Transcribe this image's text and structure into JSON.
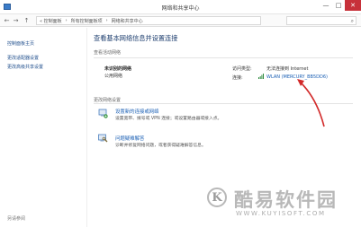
{
  "window": {
    "title": "网络和共享中心",
    "buttons": {
      "minimize": "—",
      "maximize": "□",
      "close": "✕"
    }
  },
  "address_bar": {
    "back": "←",
    "forward": "→",
    "up": "↑",
    "segments": [
      "« 控制面板",
      "›",
      "所有控制面板项",
      "›",
      "网络和共享中心"
    ],
    "search_icon": "search-icon"
  },
  "sidebar": {
    "items": [
      {
        "label": "控制面板主页"
      },
      {
        "label": "更改适配器设置"
      },
      {
        "label": "更改高级共享设置"
      }
    ],
    "footer": "另请参阅"
  },
  "main": {
    "heading": "查看基本网络信息并设置连接",
    "active_section": "查看活动网络",
    "network": {
      "name": "未识别的网络",
      "type": "公用网络",
      "access_label": "访问类型:",
      "access_value": "无法连接到 Internet",
      "conn_label": "连接:",
      "conn_value": "WLAN (MERCURY_BB5DD6)"
    },
    "change_section": "更改网络设置",
    "tasks": [
      {
        "link": "设置新的连接或网络",
        "desc": "设置宽带、拨号或 VPN 连接；或设置路由器或接入点。"
      },
      {
        "link": "问题疑难解答",
        "desc": "诊断并修复网络问题，或者获得疑难解答信息。"
      }
    ]
  },
  "watermark": {
    "logo_letter": "K",
    "title": "酷易软件园",
    "url": "WWW.KUYISOFT.COM"
  },
  "colors": {
    "link": "#1a5fb4",
    "heading": "#1c3d6e",
    "arrow": "#d22a2a",
    "close_button": "#c7313a"
  }
}
